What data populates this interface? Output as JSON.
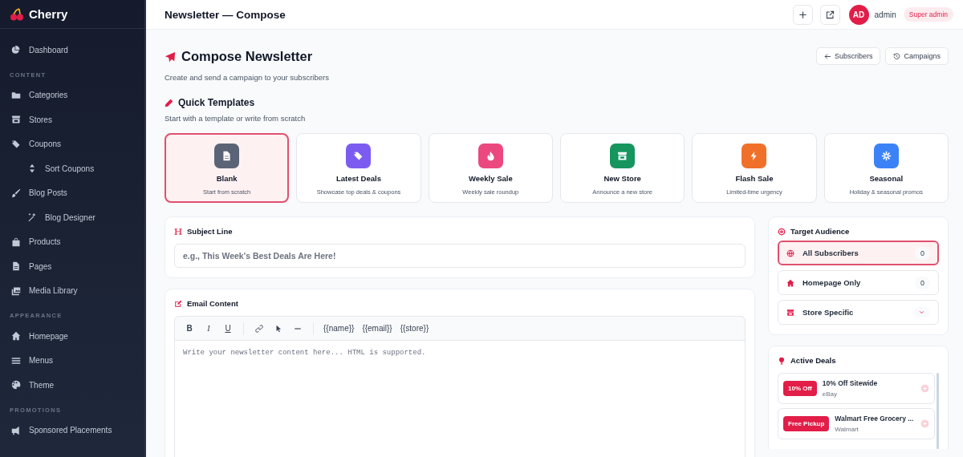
{
  "sidebar": {
    "brand": "Cherry",
    "sections": [
      {
        "items": [
          {
            "label": "Dashboard",
            "kind": "main",
            "selected": false
          }
        ]
      },
      {
        "heading": "CONTENT",
        "items": [
          {
            "label": "Categories",
            "kind": "main",
            "selected": false
          },
          {
            "label": "Stores",
            "kind": "main",
            "selected": false
          },
          {
            "label": "Coupons",
            "kind": "main",
            "selected": false
          },
          {
            "label": "Sort Coupons",
            "kind": "sub",
            "selected": false
          },
          {
            "label": "Blog Posts",
            "kind": "main",
            "selected": false
          },
          {
            "label": "Blog Designer",
            "kind": "sub",
            "selected": false
          },
          {
            "label": "Products",
            "kind": "main",
            "selected": false
          },
          {
            "label": "Pages",
            "kind": "main",
            "selected": false
          },
          {
            "label": "Media Library",
            "kind": "main",
            "selected": false
          }
        ]
      },
      {
        "heading": "APPEARANCE",
        "items": [
          {
            "label": "Homepage",
            "kind": "main",
            "selected": false
          },
          {
            "label": "Menus",
            "kind": "main",
            "selected": false
          },
          {
            "label": "Theme",
            "kind": "main",
            "selected": false
          }
        ]
      },
      {
        "heading": "PROMOTIONS",
        "items": [
          {
            "label": "Sponsored Placements",
            "kind": "main",
            "selected": false
          }
        ]
      }
    ]
  },
  "topbar": {
    "title": "Newsletter — Compose",
    "avatar": "AD",
    "user": "admin",
    "role": "Super admin"
  },
  "page": {
    "title": "Compose Newsletter",
    "subtitle": "Create and send a campaign to your subscribers",
    "buttons": [
      "Subscribers",
      "Campaigns"
    ]
  },
  "templates": {
    "heading": "Quick Templates",
    "subtitle": "Start with a template or write from scratch",
    "items": [
      {
        "name": "Blank",
        "description": "Start from scratch",
        "color": "#5b6477",
        "selected": true
      },
      {
        "name": "Latest Deals",
        "description": "Showcase top deals & coupons",
        "color": "#7c5cf0",
        "selected": false
      },
      {
        "name": "Weekly Sale",
        "description": "Weekly sale roundup",
        "color": "#ec4880",
        "selected": false
      },
      {
        "name": "New Store",
        "description": "Announce a new store",
        "color": "#16955f",
        "selected": false
      },
      {
        "name": "Flash Sale",
        "description": "Limited-time urgency",
        "color": "#f0702a",
        "selected": false
      },
      {
        "name": "Seasonal",
        "description": "Holiday & seasonal promos",
        "color": "#3b82f6",
        "selected": false
      }
    ]
  },
  "subject": {
    "label": "Subject Line",
    "placeholder": "e.g., This Week's Best Deals Are Here!"
  },
  "email": {
    "label": "Email Content",
    "format_buttons": [
      "B",
      "I",
      "U"
    ],
    "variables": [
      "{{name}}",
      "{{email}}",
      "{{store}}"
    ],
    "placeholder": "Write your newsletter content here... HTML is supported."
  },
  "audience": {
    "heading": "Target Audience",
    "options": [
      {
        "label": "All Subscribers",
        "kind": "count",
        "count": "0",
        "selected": true
      },
      {
        "label": "Homepage Only",
        "kind": "count",
        "count": "0",
        "selected": false
      },
      {
        "label": "Store Specific",
        "kind": "dropdown",
        "selected": false
      }
    ]
  },
  "deals": {
    "heading": "Active Deals",
    "items": [
      {
        "badge": "10% Off",
        "title": "10% Off Sitewide",
        "store": "eBay"
      },
      {
        "badge": "Free Pickup",
        "title": "Walmart Free Grocery ...",
        "store": "Walmart"
      }
    ]
  }
}
